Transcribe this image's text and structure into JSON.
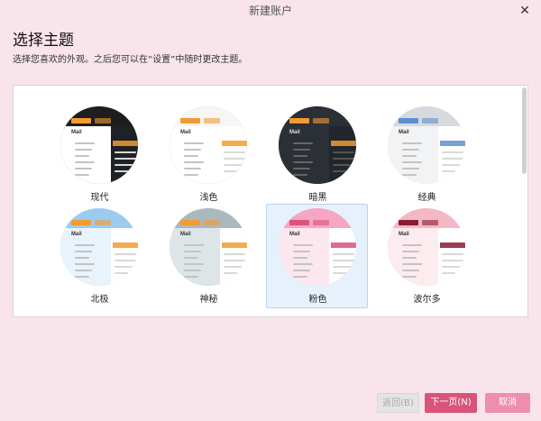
{
  "window": {
    "title": "新建账户",
    "close_symbol": "✕"
  },
  "heading": "选择主题",
  "subheading": "选择您喜欢的外观。之后您可以在“设置”中随时更改主题。",
  "themes": [
    {
      "label": "现代",
      "selected": false,
      "colors": {
        "top": "#1e1e1e",
        "accent": "#f29b30",
        "side": "#ffffff",
        "list": "#1f2126",
        "bg": "#6b6060"
      }
    },
    {
      "label": "浅色",
      "selected": false,
      "colors": {
        "top": "#f6f6f6",
        "accent": "#f29b30",
        "side": "#ffffff",
        "list": "#ffffff",
        "bg": "#8e8585"
      }
    },
    {
      "label": "暗黑",
      "selected": false,
      "colors": {
        "top": "#2b2f36",
        "accent": "#f29b30",
        "side": "#2b2f36",
        "list": "#23262c",
        "bg": "#1c1e22"
      }
    },
    {
      "label": "经典",
      "selected": false,
      "colors": {
        "top": "#d6d9dd",
        "accent": "#5b8fd1",
        "side": "#f1f3f5",
        "list": "#ffffff",
        "bg": "#c9ccd0"
      }
    },
    {
      "label": "北极",
      "selected": false,
      "colors": {
        "top": "#9ccbf0",
        "accent": "#f29b30",
        "side": "#e9f3fb",
        "list": "#ffffff",
        "bg": "#a7d3f4"
      }
    },
    {
      "label": "神秘",
      "selected": false,
      "colors": {
        "top": "#a9b9bf",
        "accent": "#f29b30",
        "side": "#dde5e8",
        "list": "#ffffff",
        "bg": "#b8c6cb"
      }
    },
    {
      "label": "粉色",
      "selected": true,
      "colors": {
        "top": "#f4a6c4",
        "accent": "#d9537a",
        "side": "#fde7ef",
        "list": "#ffffff",
        "bg": "#f6b5cd"
      }
    },
    {
      "label": "波尔多",
      "selected": false,
      "colors": {
        "top": "#f2b9c5",
        "accent": "#8b1a33",
        "side": "#fdecef",
        "list": "#ffffff",
        "bg": "#f3c2cc"
      }
    }
  ],
  "preview": {
    "app_label": "Mail"
  },
  "buttons": {
    "back": "返回(B)",
    "next": "下一页(N)",
    "cancel": "取消"
  }
}
